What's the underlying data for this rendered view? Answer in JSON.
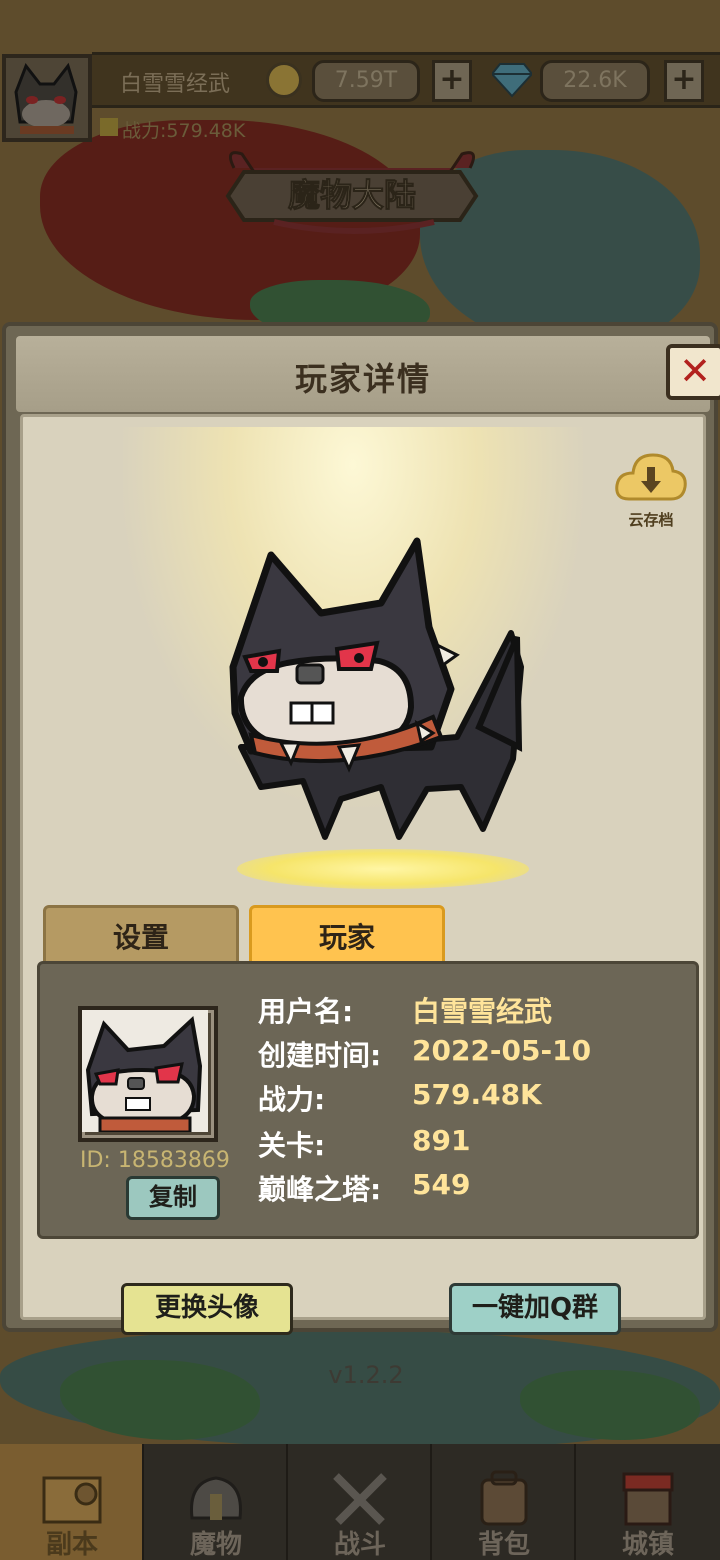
{
  "hud": {
    "player_name": "白雪雪经武",
    "gold": "7.59T",
    "gems": "22.6K",
    "power_text": "战力:579.48K",
    "plus": "+"
  },
  "region": {
    "title": "魔物大陆"
  },
  "modal": {
    "title": "玩家详情",
    "close": "✕",
    "cloud_save_label": "云存档",
    "tabs": {
      "settings": "设置",
      "player": "玩家"
    },
    "info": {
      "id_text": "ID: 18583869",
      "copy_label": "复制",
      "rows": [
        {
          "label": "用户名:",
          "value": "白雪雪经武"
        },
        {
          "label": "创建时间:",
          "value": "2022-05-10"
        },
        {
          "label": "战力:",
          "value": "579.48K"
        },
        {
          "label": "关卡:",
          "value": "891"
        },
        {
          "label": "巅峰之塔:",
          "value": "549"
        }
      ]
    },
    "change_avatar_label": "更换头像",
    "join_qq_label": "一键加Q群",
    "version": "v1.2.2"
  },
  "nav": {
    "items": [
      {
        "label": "副本",
        "icon": "map-scroll-icon"
      },
      {
        "label": "魔物",
        "icon": "monster-helmet-icon"
      },
      {
        "label": "战斗",
        "icon": "crossed-swords-icon"
      },
      {
        "label": "背包",
        "icon": "backpack-icon"
      },
      {
        "label": "城镇",
        "icon": "town-building-icon"
      }
    ],
    "active_index": 0
  },
  "colors": {
    "tab_active": "#ffc34f",
    "close_x": "#b2211e",
    "value_text": "#ffe49a"
  }
}
